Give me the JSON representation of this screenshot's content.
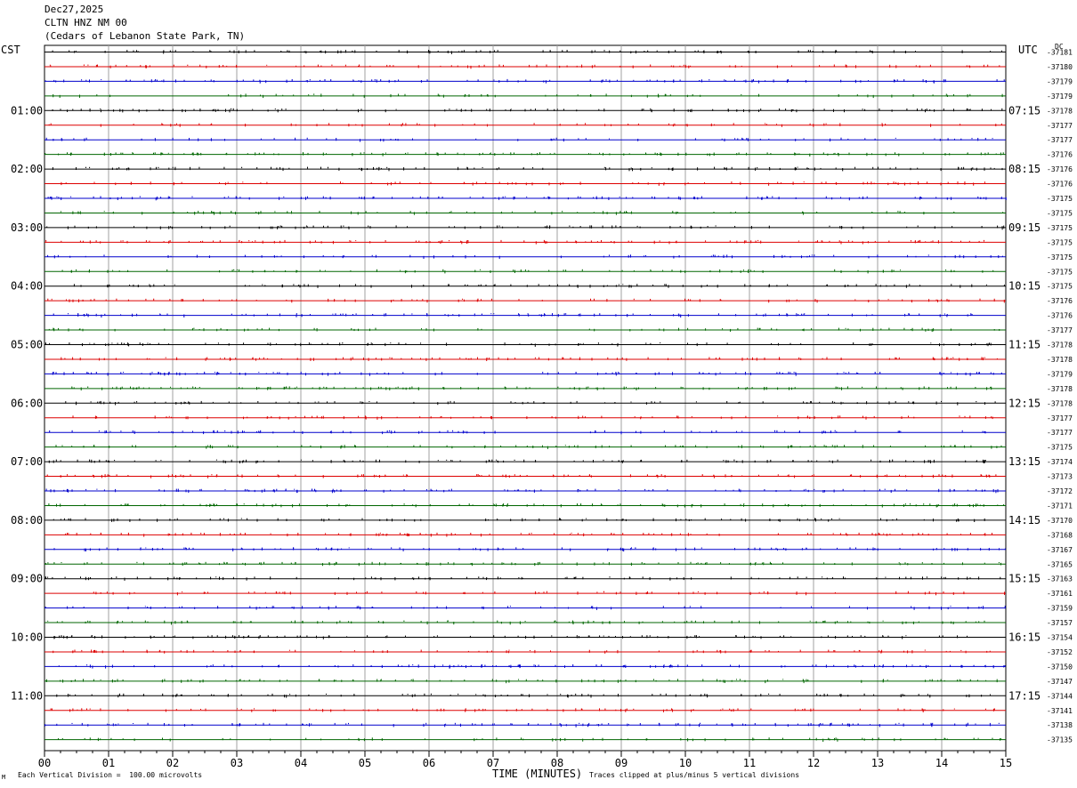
{
  "header": {
    "date": "Dec27,2025",
    "station": "CLTN HNZ NM 00",
    "location": "(Cedars of Lebanon State Park, TN)"
  },
  "left_zone": "CST",
  "right_zone": "UTC",
  "right_zone_sub": "DC",
  "footer": {
    "scale_note": "Each Vertical Division =  100.00 microvolts",
    "clip_note": "Traces clipped at plus/minus 5 vertical divisions",
    "mark": "M"
  },
  "chart_data": {
    "type": "line",
    "subtype": "helicorder",
    "xlabel": "TIME (MINUTES)",
    "xlim": [
      0,
      15
    ],
    "x_ticks": [
      "00",
      "01",
      "02",
      "03",
      "04",
      "05",
      "06",
      "07",
      "08",
      "09",
      "10",
      "11",
      "12",
      "13",
      "14",
      "15"
    ],
    "trace_colors": [
      "#000000",
      "#dd0000",
      "#0000cc",
      "#006600"
    ],
    "grid_color": "#a0a0a0",
    "left_hour_labels": [
      "01:00",
      "02:00",
      "03:00",
      "04:00",
      "05:00",
      "06:00",
      "07:00",
      "08:00",
      "09:00",
      "10:00",
      "11:00"
    ],
    "right_hour_labels": [
      "07:15",
      "08:15",
      "09:15",
      "10:15",
      "11:15",
      "12:15",
      "13:15",
      "14:15",
      "15:15",
      "16:15",
      "17:15"
    ],
    "dc_offsets": [
      "-37181",
      "-37180",
      "-37179",
      "-37179",
      "-37178",
      "-37177",
      "-37177",
      "-37176",
      "-37176",
      "-37176",
      "-37175",
      "-37175",
      "-37175",
      "-37175",
      "-37175",
      "-37175",
      "-37175",
      "-37176",
      "-37176",
      "-37177",
      "-37178",
      "-37178",
      "-37179",
      "-37178",
      "-37178",
      "-37177",
      "-37177",
      "-37175",
      "-37174",
      "-37173",
      "-37172",
      "-37171",
      "-37170",
      "-37168",
      "-37167",
      "-37165",
      "-37163",
      "-37161",
      "-37159",
      "-37157",
      "-37154",
      "-37152",
      "-37150",
      "-37147",
      "-37144",
      "-37141",
      "-37138",
      "-37135"
    ],
    "trace_count": 48,
    "trace_interval_minutes": 15
  }
}
